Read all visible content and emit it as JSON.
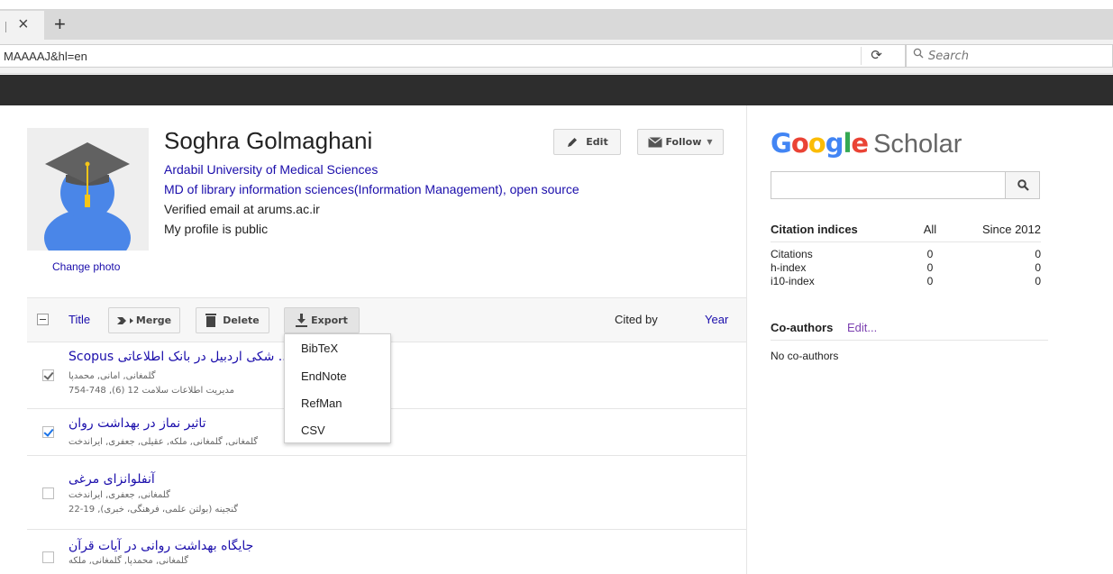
{
  "browser": {
    "url": "MAAAAJ&hl=en",
    "search_placeholder": "Search"
  },
  "profile": {
    "name": "Soghra Golmaghani",
    "affiliation": "Ardabil University of Medical Sciences",
    "interests": "MD of library information sciences(Information Management), open source",
    "email": "Verified email at arums.ac.ir",
    "public_status": "My profile is public",
    "change_photo": "Change photo",
    "edit_label": "Edit",
    "follow_label": "Follow"
  },
  "table": {
    "title_col": "Title",
    "merge_label": "Merge",
    "delete_label": "Delete",
    "export_label": "Export",
    "cited_by_col": "Cited by",
    "year_col": "Year"
  },
  "export_menu": {
    "items": [
      "BibTeX",
      "EndNote",
      "RefMan",
      "CSV"
    ]
  },
  "articles": [
    {
      "title": "تولیدات ... شکی اردبیل در بانک اطلاعاتی Scopus",
      "authors": "گلمغانی, امانی, محمدپا",
      "venue": "مدیریت اطلاعات سلامت 12 (6), 748-754",
      "checked": true
    },
    {
      "title": "تاثیر نماز در بهداشت روان",
      "authors": "گلمغانی, گلمغانی, ملکه, عقیلی, جعفری, ایراندخت",
      "venue": "",
      "checked": true
    },
    {
      "title": "آنفلوانزای مرغی",
      "authors": "گلمغانی, جعفری, ایراندخت",
      "venue": "گنجینه (بولتن علمی، فرهنگی، خبری), 19-22",
      "checked": false
    },
    {
      "title": "جایگاه بهداشت روانی در آیات قرآن",
      "authors": "گلمغانی, محمدپا, گلمغانی, ملکه",
      "venue": "",
      "checked": false
    }
  ],
  "sidebar": {
    "logo_google": "Google",
    "logo_scholar": "Scholar",
    "citation_header": "Citation indices",
    "col_all": "All",
    "col_since": "Since 2012",
    "rows": [
      {
        "label": "Citations",
        "all": "0",
        "since": "0"
      },
      {
        "label": "h-index",
        "all": "0",
        "since": "0"
      },
      {
        "label": "i10-index",
        "all": "0",
        "since": "0"
      }
    ],
    "coauthors_title": "Co-authors",
    "coauthors_edit": "Edit...",
    "no_coauthors": "No co-authors"
  },
  "colors": {
    "link": "#1a0dab",
    "header_bar": "#2d2d2d",
    "google_blue": "#4285f4",
    "google_red": "#ea4335",
    "google_yellow": "#fbbc05",
    "google_green": "#34a853",
    "watermark": "#7bd66b"
  },
  "icons": [
    "close-icon",
    "plus-icon",
    "reload-icon",
    "search-icon",
    "graduation-cap-avatar",
    "pencil-icon",
    "envelope-icon",
    "chevron-down-icon",
    "merge-arrow-icon",
    "trash-icon",
    "download-icon",
    "checkbox-icon"
  ]
}
